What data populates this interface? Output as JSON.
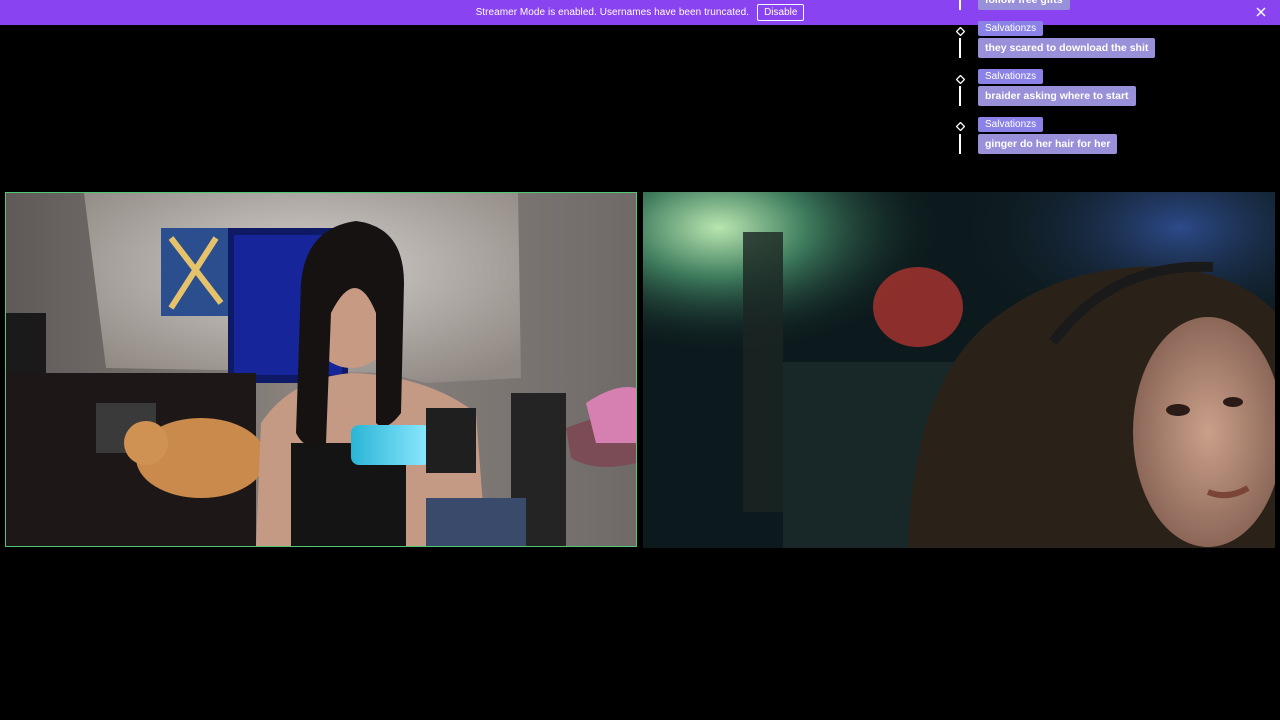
{
  "banner": {
    "text": "Streamer Mode is enabled. Usernames have been truncated.",
    "disable_label": "Disable",
    "background": "#8a43f0"
  },
  "chat": {
    "messages": [
      {
        "user": "",
        "text": "follow free gifts"
      },
      {
        "user": "Salvationzs",
        "text": "they scared to download the shit"
      },
      {
        "user": "Salvationzs",
        "text": "braider asking where to start"
      },
      {
        "user": "Salvationzs",
        "text": "ginger do her hair for her"
      }
    ],
    "user_badge_color": "#8a82e6",
    "message_color": "#9890d8"
  },
  "video": {
    "left_tile_border": "#4fc774"
  }
}
